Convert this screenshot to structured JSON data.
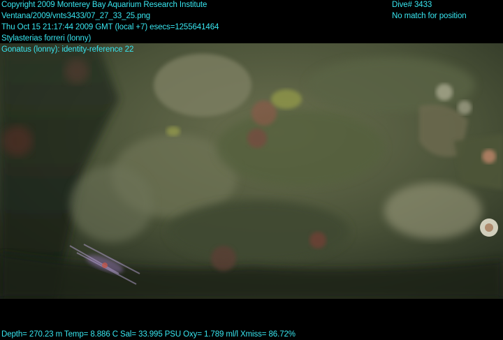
{
  "overlay": {
    "copyright": "Copyright 2009 Monterey Bay Aquarium Research Institute",
    "file_path": "Ventana/2009/vnts3433/07_27_33_25.png",
    "timestamp": "Thu Oct 15 21:17:44 2009 GMT (local +7)  esecs=1255641464",
    "annotation_1": "Stylasterias forreri (lonny)",
    "annotation_2": "Gonatus (lonny): identity-reference 22",
    "dive": "Dive# 3433",
    "position_status": "No match for position",
    "telemetry": "Depth= 270.23 m  Temp= 8.886 C  Sal= 33.995 PSU  Oxy= 1.789 ml/l  Xmiss= 86.72%"
  },
  "colors": {
    "overlay_text": "#38e6f0",
    "band": "#000000",
    "water_dark": "#1f2a1e",
    "rock": "#5b6446"
  }
}
